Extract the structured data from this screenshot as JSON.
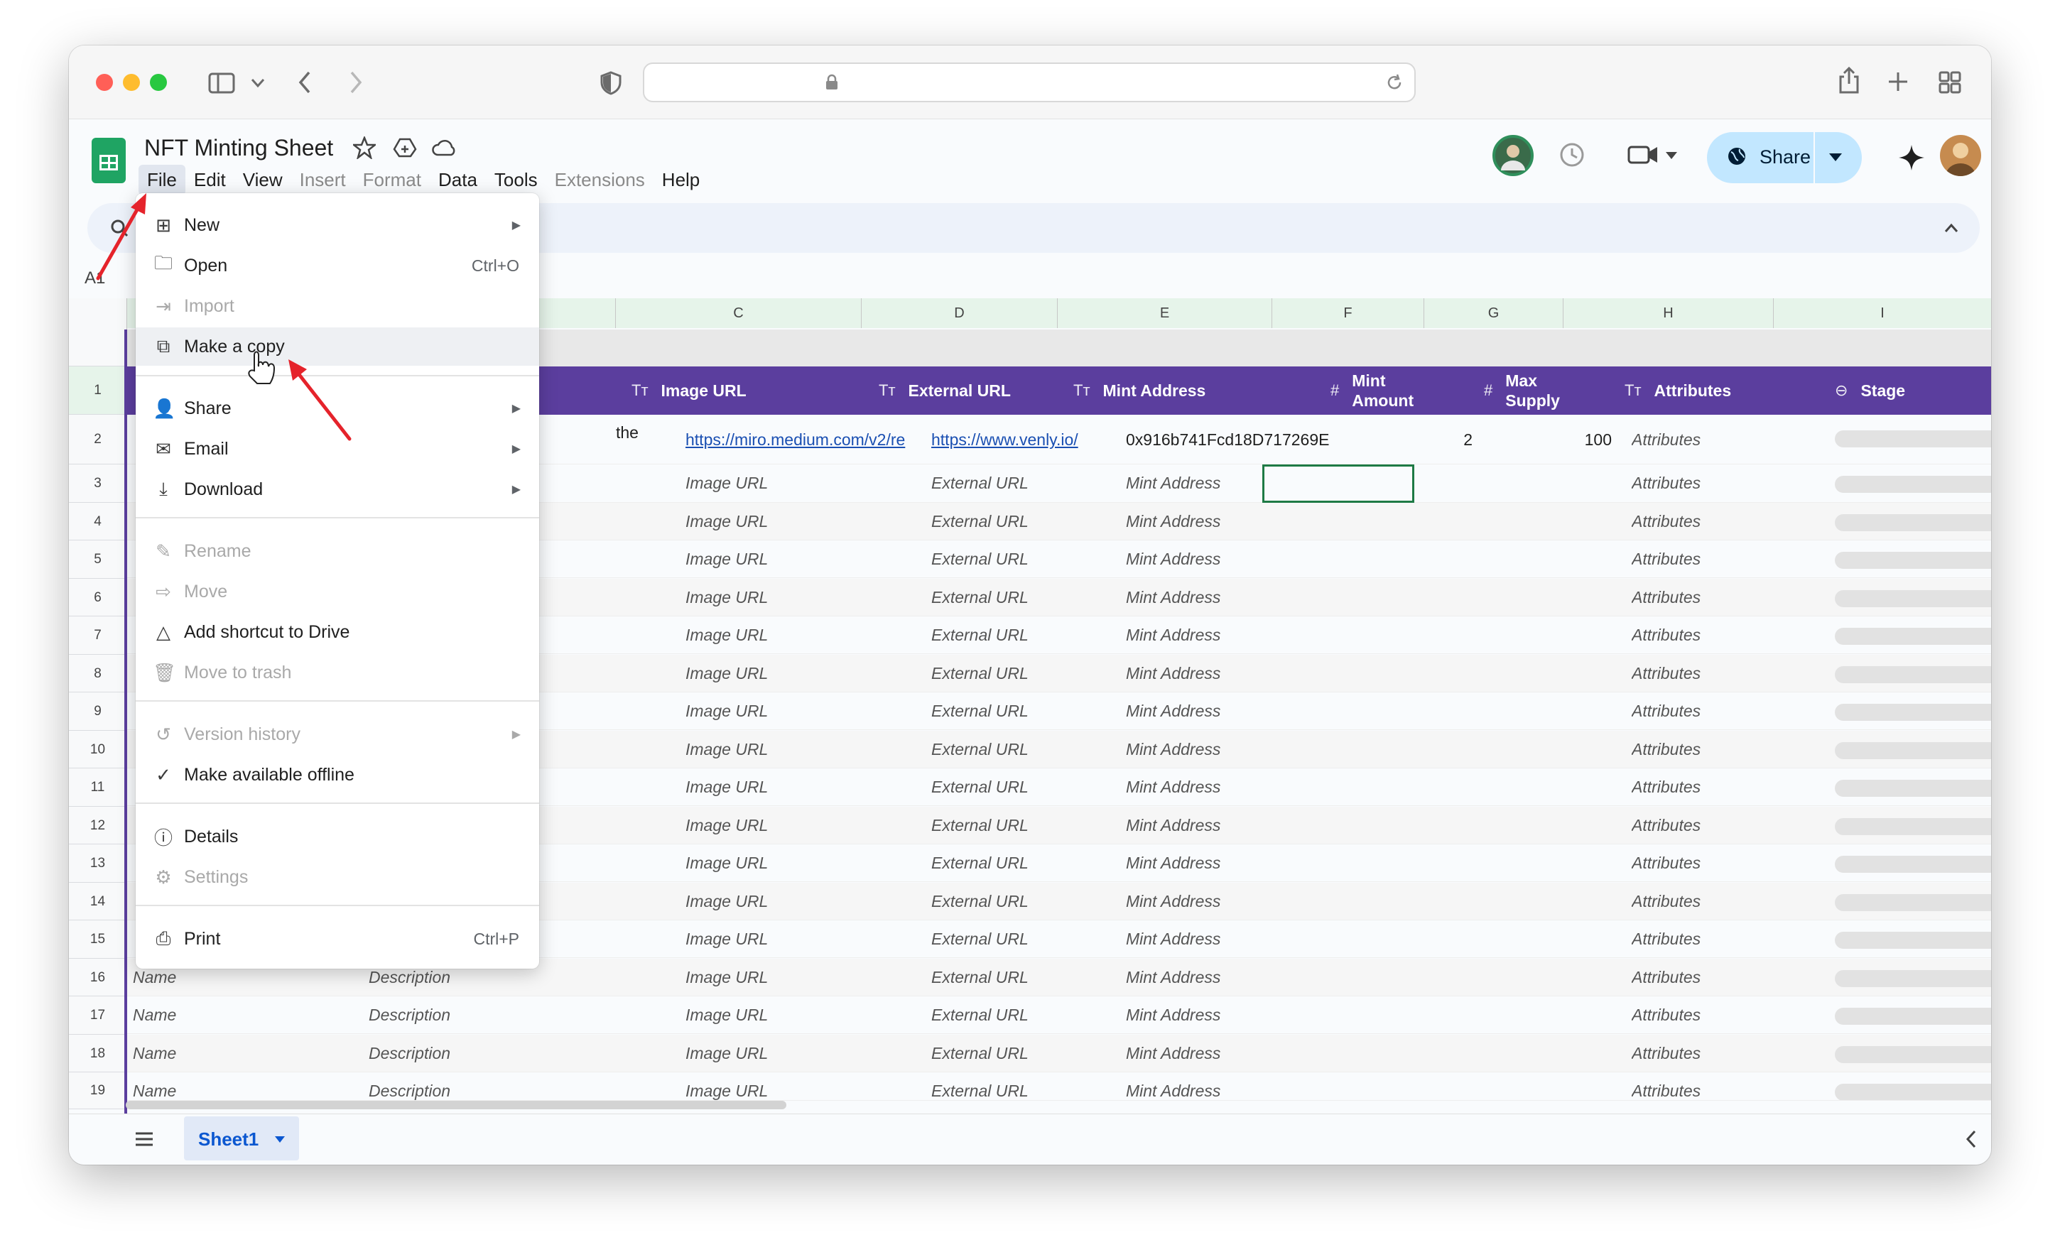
{
  "app": {
    "doc_title": "NFT Minting Sheet",
    "name_box": "A1",
    "menubar": [
      {
        "label": "File",
        "disabled": false
      },
      {
        "label": "Edit",
        "disabled": false
      },
      {
        "label": "View",
        "disabled": false
      },
      {
        "label": "Insert",
        "disabled": true
      },
      {
        "label": "Format",
        "disabled": true
      },
      {
        "label": "Data",
        "disabled": false
      },
      {
        "label": "Tools",
        "disabled": false
      },
      {
        "label": "Extensions",
        "disabled": true
      },
      {
        "label": "Help",
        "disabled": false
      }
    ],
    "share_label": "Share",
    "icons": {
      "star": "star-icon",
      "move": "drive-move-icon",
      "cloud": "cloud-status-icon",
      "history": "history-icon",
      "meet": "video-call-icon",
      "gemini": "sparkle-icon"
    }
  },
  "grid": {
    "columns": [
      "C",
      "D",
      "E",
      "F",
      "G",
      "H",
      "I"
    ],
    "rows": [
      "1",
      "2",
      "3",
      "4",
      "5",
      "6",
      "7",
      "8",
      "9",
      "10",
      "11",
      "12",
      "13",
      "14",
      "15",
      "16",
      "17",
      "18",
      "19"
    ],
    "headers": [
      {
        "icon": "Tт",
        "label": "Image URL"
      },
      {
        "icon": "Tт",
        "label": "External URL"
      },
      {
        "icon": "Tт",
        "label": "Mint Address"
      },
      {
        "icon": "#",
        "label": "Mint Amount"
      },
      {
        "icon": "#",
        "label": "Max Supply"
      },
      {
        "icon": "Tт",
        "label": "Attributes"
      },
      {
        "icon": "⊖",
        "label": "Stage"
      }
    ],
    "row2": {
      "b_fragment": "the",
      "image_url": "https://miro.medium.com/v2/re",
      "external_url": "https://www.venly.io/",
      "mint_address": "0x916b741Fcd18D717269E",
      "mint_amount": "2",
      "max_supply": "100",
      "attributes": "Attributes"
    },
    "placeholders": {
      "name": "Name",
      "description": "Description",
      "image_url": "Image URL",
      "external_url": "External URL",
      "mint_address": "Mint Address",
      "attributes": "Attributes"
    },
    "sheet_tab": "Sheet1"
  },
  "file_menu": {
    "items": [
      {
        "label": "New",
        "icon": "new-sheet-icon",
        "glyph": "⊞",
        "submenu": true,
        "disabled": false
      },
      {
        "label": "Open",
        "icon": "folder-icon",
        "glyph": "🗀",
        "shortcut": "Ctrl+O",
        "disabled": false
      },
      {
        "label": "Import",
        "icon": "import-icon",
        "glyph": "⇥",
        "disabled": true
      },
      {
        "label": "Make a copy",
        "icon": "copy-icon",
        "glyph": "⧉",
        "disabled": false,
        "hover": true
      },
      {
        "label": "Share",
        "icon": "person-add-icon",
        "glyph": "👤",
        "submenu": true,
        "disabled": false
      },
      {
        "label": "Email",
        "icon": "email-icon",
        "glyph": "✉",
        "submenu": true,
        "disabled": false
      },
      {
        "label": "Download",
        "icon": "download-icon",
        "glyph": "⤓",
        "submenu": true,
        "disabled": false
      },
      {
        "label": "Rename",
        "icon": "rename-icon",
        "glyph": "✎",
        "disabled": true
      },
      {
        "label": "Move",
        "icon": "move-folder-icon",
        "glyph": "⇨",
        "disabled": true
      },
      {
        "label": "Add shortcut to Drive",
        "icon": "drive-shortcut-icon",
        "glyph": "△",
        "disabled": false
      },
      {
        "label": "Move to trash",
        "icon": "trash-icon",
        "glyph": "🗑",
        "disabled": true
      },
      {
        "label": "Version history",
        "icon": "history-icon",
        "glyph": "↺",
        "submenu": true,
        "disabled": true
      },
      {
        "label": "Make available offline",
        "icon": "offline-icon",
        "glyph": "✓",
        "disabled": false
      },
      {
        "label": "Details",
        "icon": "info-icon",
        "glyph": "ⓘ",
        "disabled": false
      },
      {
        "label": "Settings",
        "icon": "settings-icon",
        "glyph": "⚙",
        "disabled": true
      },
      {
        "label": "Print",
        "icon": "print-icon",
        "glyph": "⎙",
        "shortcut": "Ctrl+P",
        "disabled": false
      }
    ]
  },
  "colors": {
    "header_purple": "#5b3e9e",
    "sheets_green": "#1fa463",
    "share_blue": "#c2e7ff",
    "annotation_red": "#e5232b"
  }
}
